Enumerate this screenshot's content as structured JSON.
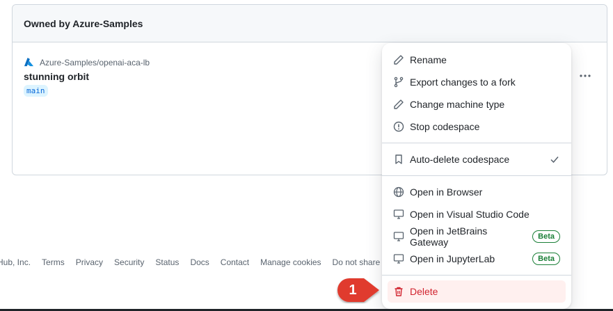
{
  "panel": {
    "header": "Owned by Azure-Samples",
    "repo": "Azure-Samples/openai-aca-lb",
    "codespace_name": "stunning orbit",
    "branch": "main"
  },
  "footer": {
    "links": [
      "Hub, Inc.",
      "Terms",
      "Privacy",
      "Security",
      "Status",
      "Docs",
      "Contact",
      "Manage cookies",
      "Do not share my"
    ]
  },
  "menu": {
    "rename": "Rename",
    "export": "Export changes to a fork",
    "change_machine": "Change machine type",
    "stop": "Stop codespace",
    "auto_delete": "Auto-delete codespace",
    "open_browser": "Open in Browser",
    "open_vscode": "Open in Visual Studio Code",
    "open_jetbrains": "Open in JetBrains Gateway",
    "open_jupyter": "Open in JupyterLab",
    "beta": "Beta",
    "delete": "Delete"
  },
  "callout": {
    "number": "1",
    "color": "#e03b2e"
  },
  "colors": {
    "danger": "#d1242f",
    "success": "#1a7f37",
    "link": "#0969da"
  }
}
